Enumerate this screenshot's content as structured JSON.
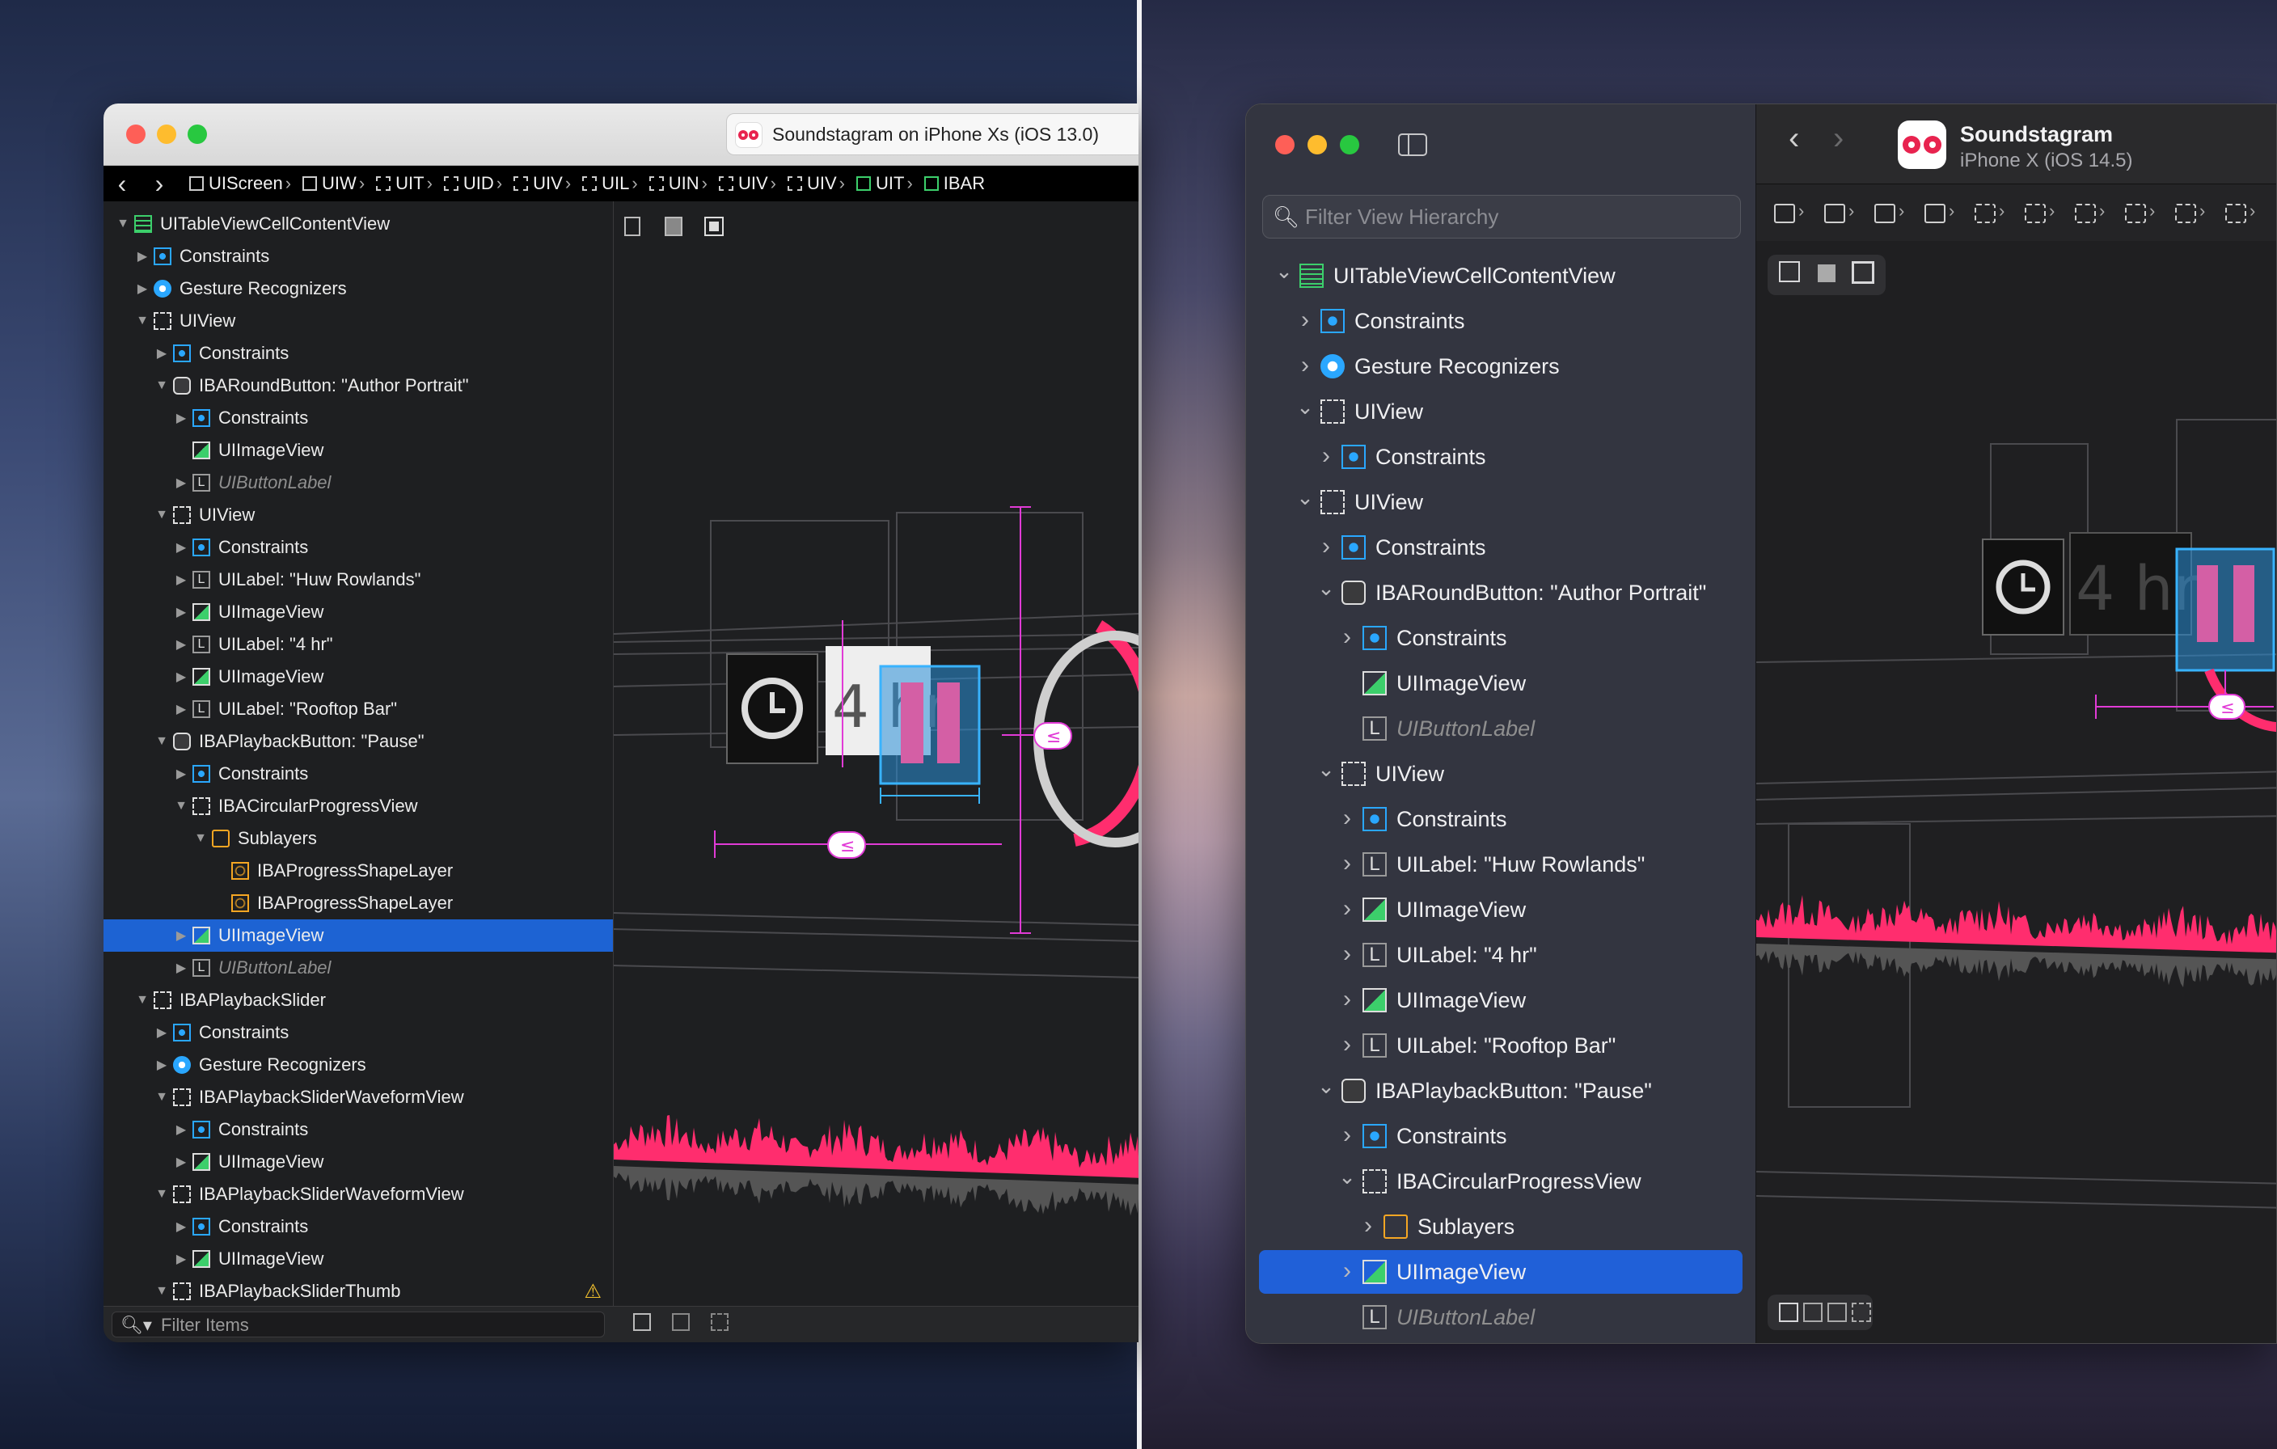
{
  "left_window": {
    "title": "Soundstagram on iPhone Xs (iOS 13.0)",
    "breadcrumbs": [
      "UIScreen",
      "UIW",
      "UIT",
      "UID",
      "UIV",
      "UIL",
      "UIN",
      "UIV",
      "UIV",
      "UIT",
      "IBAR"
    ],
    "canvas_label": "4 hr",
    "filter_placeholder": "Filter Items",
    "tree": [
      {
        "depth": 0,
        "disc": "open",
        "icon": "text-view",
        "label": "UITableViewCellContentView"
      },
      {
        "depth": 1,
        "disc": "closed",
        "icon": "constraint",
        "label": "Constraints"
      },
      {
        "depth": 1,
        "disc": "closed",
        "icon": "gesture",
        "label": "Gesture Recognizers"
      },
      {
        "depth": 1,
        "disc": "open",
        "icon": "view",
        "label": "UIView"
      },
      {
        "depth": 2,
        "disc": "closed",
        "icon": "constraint",
        "label": "Constraints"
      },
      {
        "depth": 2,
        "disc": "open",
        "icon": "button",
        "label": "IBARoundButton: \"Author Portrait\""
      },
      {
        "depth": 3,
        "disc": "closed",
        "icon": "constraint",
        "label": "Constraints"
      },
      {
        "depth": 3,
        "disc": "none",
        "icon": "image",
        "label": "UIImageView"
      },
      {
        "depth": 3,
        "disc": "closed",
        "icon": "label",
        "label": "UIButtonLabel",
        "dim": true
      },
      {
        "depth": 2,
        "disc": "open",
        "icon": "view",
        "label": "UIView"
      },
      {
        "depth": 3,
        "disc": "closed",
        "icon": "constraint",
        "label": "Constraints"
      },
      {
        "depth": 3,
        "disc": "closed",
        "icon": "label",
        "label": "UILabel: \"Huw Rowlands\""
      },
      {
        "depth": 3,
        "disc": "closed",
        "icon": "image",
        "label": "UIImageView"
      },
      {
        "depth": 3,
        "disc": "closed",
        "icon": "label",
        "label": "UILabel: \"4 hr\""
      },
      {
        "depth": 3,
        "disc": "closed",
        "icon": "image",
        "label": "UIImageView"
      },
      {
        "depth": 3,
        "disc": "closed",
        "icon": "label",
        "label": "UILabel: \"Rooftop Bar\""
      },
      {
        "depth": 2,
        "disc": "open",
        "icon": "button",
        "label": "IBAPlaybackButton: \"Pause\""
      },
      {
        "depth": 3,
        "disc": "closed",
        "icon": "constraint",
        "label": "Constraints"
      },
      {
        "depth": 3,
        "disc": "open",
        "icon": "view",
        "label": "IBACircularProgressView"
      },
      {
        "depth": 4,
        "disc": "open",
        "icon": "layer",
        "label": "Sublayers"
      },
      {
        "depth": 5,
        "disc": "none",
        "icon": "shape",
        "label": "IBAProgressShapeLayer"
      },
      {
        "depth": 5,
        "disc": "none",
        "icon": "shape",
        "label": "IBAProgressShapeLayer"
      },
      {
        "depth": 3,
        "disc": "closed",
        "icon": "image",
        "label": "UIImageView",
        "selected": true
      },
      {
        "depth": 3,
        "disc": "closed",
        "icon": "label",
        "label": "UIButtonLabel",
        "dim": true
      },
      {
        "depth": 1,
        "disc": "open",
        "icon": "view",
        "label": "IBAPlaybackSlider"
      },
      {
        "depth": 2,
        "disc": "closed",
        "icon": "constraint",
        "label": "Constraints"
      },
      {
        "depth": 2,
        "disc": "closed",
        "icon": "gesture",
        "label": "Gesture Recognizers"
      },
      {
        "depth": 2,
        "disc": "open",
        "icon": "view",
        "label": "IBAPlaybackSliderWaveformView"
      },
      {
        "depth": 3,
        "disc": "closed",
        "icon": "constraint",
        "label": "Constraints"
      },
      {
        "depth": 3,
        "disc": "closed",
        "icon": "image",
        "label": "UIImageView"
      },
      {
        "depth": 2,
        "disc": "open",
        "icon": "view",
        "label": "IBAPlaybackSliderWaveformView"
      },
      {
        "depth": 3,
        "disc": "closed",
        "icon": "constraint",
        "label": "Constraints"
      },
      {
        "depth": 3,
        "disc": "closed",
        "icon": "image",
        "label": "UIImageView"
      },
      {
        "depth": 2,
        "disc": "open",
        "icon": "view",
        "label": "IBAPlaybackSliderThumb",
        "warning": true
      }
    ]
  },
  "right_window": {
    "app_name": "Soundstagram",
    "device": "iPhone X (iOS 14.5)",
    "search_placeholder": "Filter View Hierarchy",
    "canvas_label": "4 hr",
    "tree": [
      {
        "depth": 0,
        "disc": "open",
        "icon": "text-view",
        "label": "UITableViewCellContentView"
      },
      {
        "depth": 1,
        "disc": "closed",
        "icon": "constraint",
        "label": "Constraints"
      },
      {
        "depth": 1,
        "disc": "closed",
        "icon": "gesture",
        "label": "Gesture Recognizers"
      },
      {
        "depth": 1,
        "disc": "open",
        "icon": "view",
        "label": "UIView"
      },
      {
        "depth": 2,
        "disc": "closed",
        "icon": "constraint",
        "label": "Constraints"
      },
      {
        "depth": 1,
        "disc": "open",
        "icon": "view",
        "label": "UIView"
      },
      {
        "depth": 2,
        "disc": "closed",
        "icon": "constraint",
        "label": "Constraints"
      },
      {
        "depth": 2,
        "disc": "open",
        "icon": "button",
        "label": "IBARoundButton: \"Author Portrait\""
      },
      {
        "depth": 3,
        "disc": "closed",
        "icon": "constraint",
        "label": "Constraints"
      },
      {
        "depth": 3,
        "disc": "none",
        "icon": "image",
        "label": "UIImageView"
      },
      {
        "depth": 3,
        "disc": "none",
        "icon": "label",
        "label": "UIButtonLabel",
        "dim": true
      },
      {
        "depth": 2,
        "disc": "open",
        "icon": "view",
        "label": "UIView"
      },
      {
        "depth": 3,
        "disc": "closed",
        "icon": "constraint",
        "label": "Constraints"
      },
      {
        "depth": 3,
        "disc": "closed",
        "icon": "label",
        "label": "UILabel: \"Huw Rowlands\""
      },
      {
        "depth": 3,
        "disc": "closed",
        "icon": "image",
        "label": "UIImageView"
      },
      {
        "depth": 3,
        "disc": "closed",
        "icon": "label",
        "label": "UILabel: \"4 hr\""
      },
      {
        "depth": 3,
        "disc": "closed",
        "icon": "image",
        "label": "UIImageView"
      },
      {
        "depth": 3,
        "disc": "closed",
        "icon": "label",
        "label": "UILabel: \"Rooftop Bar\""
      },
      {
        "depth": 2,
        "disc": "open",
        "icon": "button",
        "label": "IBAPlaybackButton: \"Pause\""
      },
      {
        "depth": 3,
        "disc": "closed",
        "icon": "constraint",
        "label": "Constraints"
      },
      {
        "depth": 3,
        "disc": "open",
        "icon": "view",
        "label": "IBACircularProgressView"
      },
      {
        "depth": 4,
        "disc": "closed",
        "icon": "layer",
        "label": "Sublayers"
      },
      {
        "depth": 3,
        "disc": "closed",
        "icon": "image",
        "label": "UIImageView",
        "selected": true
      },
      {
        "depth": 3,
        "disc": "none",
        "icon": "label",
        "label": "UIButtonLabel",
        "dim": true
      }
    ]
  },
  "colors": {
    "accent_pink": "#ff2d6e",
    "selection_blue": "#1d63d3",
    "constraint_blue": "#2aa7ff",
    "layer_orange": "#f5a623",
    "image_green": "#3ccf6b"
  }
}
